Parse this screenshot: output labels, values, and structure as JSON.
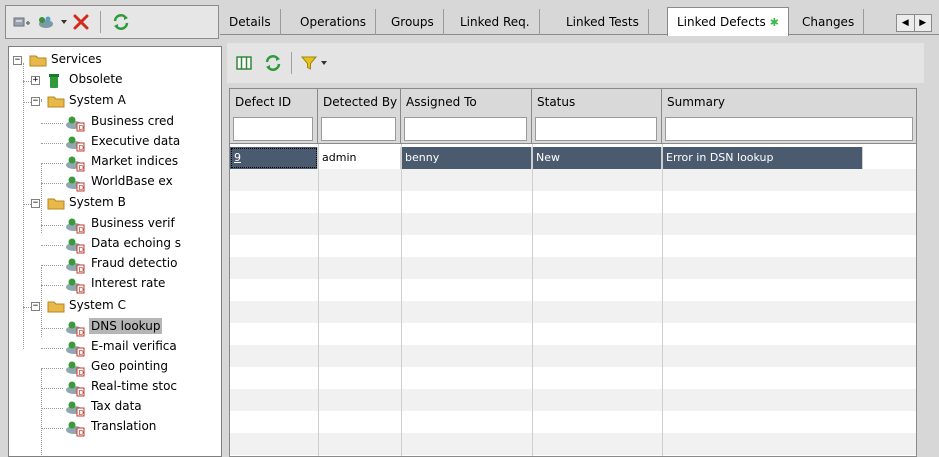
{
  "left_toolbar": {
    "icons": [
      "new-service-icon",
      "service-action-icon",
      "dropdown-arrow-icon",
      "delete-icon",
      "refresh-icon"
    ]
  },
  "tree": {
    "root": "Services",
    "obsolete": "Obsolete",
    "system_a": {
      "label": "System A",
      "children": [
        "Business cred",
        "Executive data",
        "Market indices",
        "WorldBase ex"
      ]
    },
    "system_b": {
      "label": "System B",
      "children": [
        "Business verif",
        "Data echoing s",
        "Fraud detectio",
        "Interest rate"
      ]
    },
    "system_c": {
      "label": "System C",
      "children": [
        "DNS lookup",
        "E-mail verifica",
        "Geo pointing",
        "Real-time stoc",
        "Tax data",
        "Translation"
      ]
    },
    "selected": "DNS lookup"
  },
  "tabs": [
    {
      "label": "Details"
    },
    {
      "label": "Operations"
    },
    {
      "label": "Groups"
    },
    {
      "label": "Linked Req."
    },
    {
      "label": "Linked Tests"
    },
    {
      "label": "Linked Defects",
      "marker": "✱",
      "active": true
    },
    {
      "label": "Changes"
    }
  ],
  "grid": {
    "columns": [
      "Defect ID",
      "Detected By",
      "Assigned To",
      "Status",
      "Summary"
    ],
    "rows": [
      {
        "defect_id": "9",
        "detected_by": "admin",
        "assigned_to": "benny",
        "status": "New",
        "summary": "Error in DSN lookup"
      }
    ]
  },
  "colors": {
    "selection": "#4a5b70",
    "refresh_green": "#2e9a3a",
    "delete_red": "#d42a1c",
    "filter_yellow": "#e8c21a"
  }
}
